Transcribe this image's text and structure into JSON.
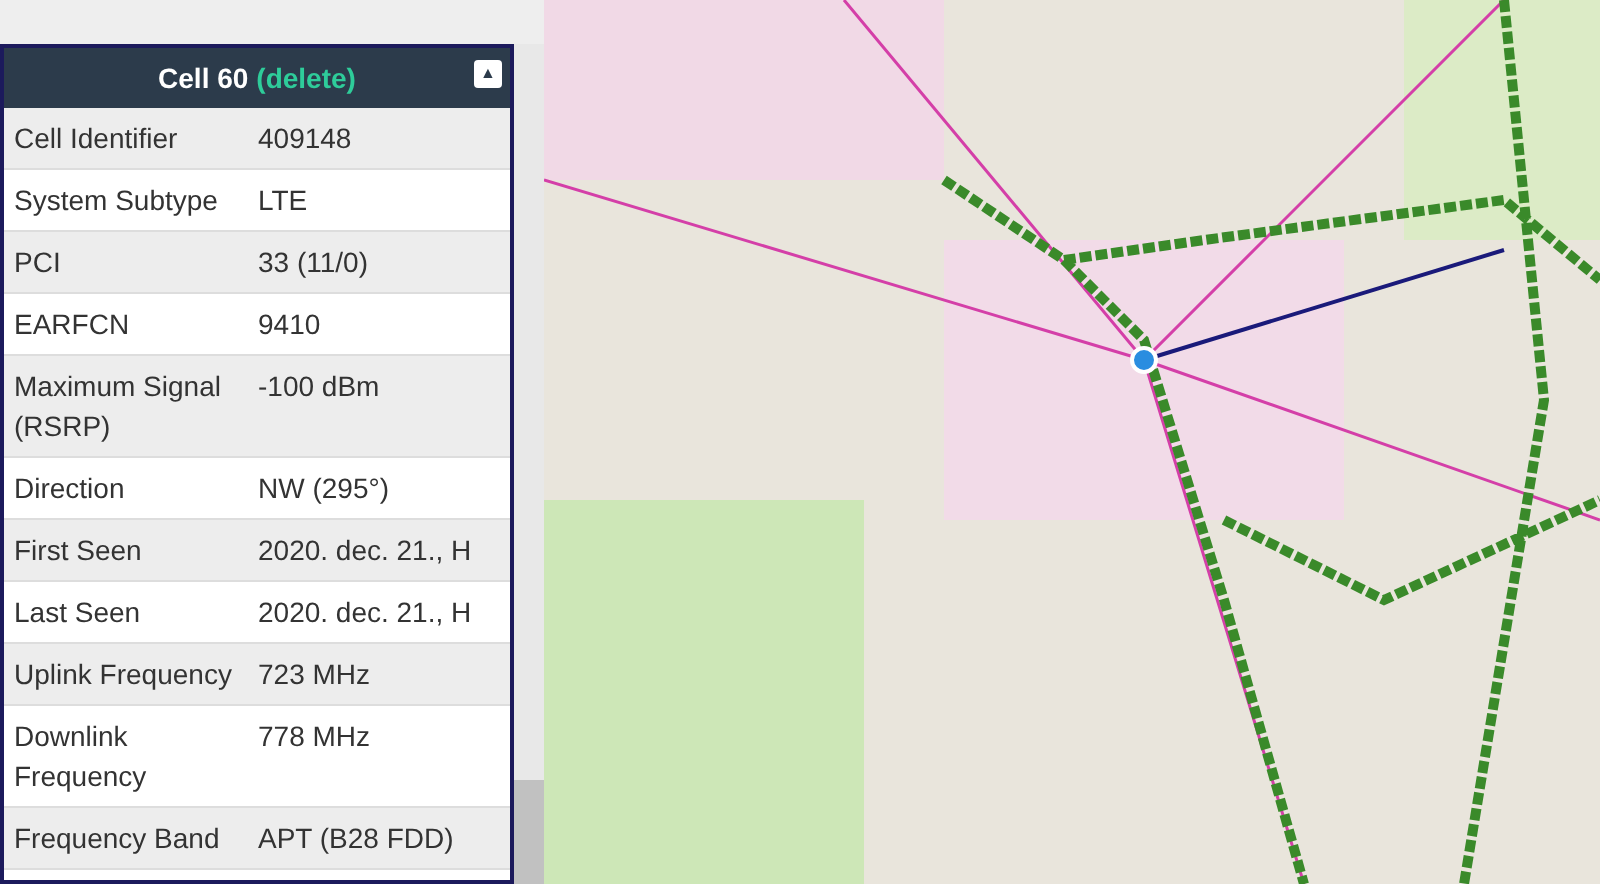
{
  "panel": {
    "title": "Cell 60",
    "action": "(delete)",
    "collapse_icon": "▲",
    "rows": [
      {
        "label": "Cell Identifier",
        "value": "409148"
      },
      {
        "label": "System Subtype",
        "value": "LTE"
      },
      {
        "label": "PCI",
        "value": "33 (11/0)"
      },
      {
        "label": "EARFCN",
        "value": "9410"
      },
      {
        "label": "Maximum Signal (RSRP)",
        "value": "-100 dBm"
      },
      {
        "label": "Direction",
        "value": "NW (295°)"
      },
      {
        "label": "First Seen",
        "value": "2020. dec. 21., H"
      },
      {
        "label": "Last Seen",
        "value": "2020. dec. 21., H"
      },
      {
        "label": "Uplink Frequency",
        "value": "723 MHz"
      },
      {
        "label": "Downlink Frequency",
        "value": "778 MHz"
      },
      {
        "label": "Frequency Band",
        "value": "APT (B28 FDD)"
      }
    ]
  }
}
